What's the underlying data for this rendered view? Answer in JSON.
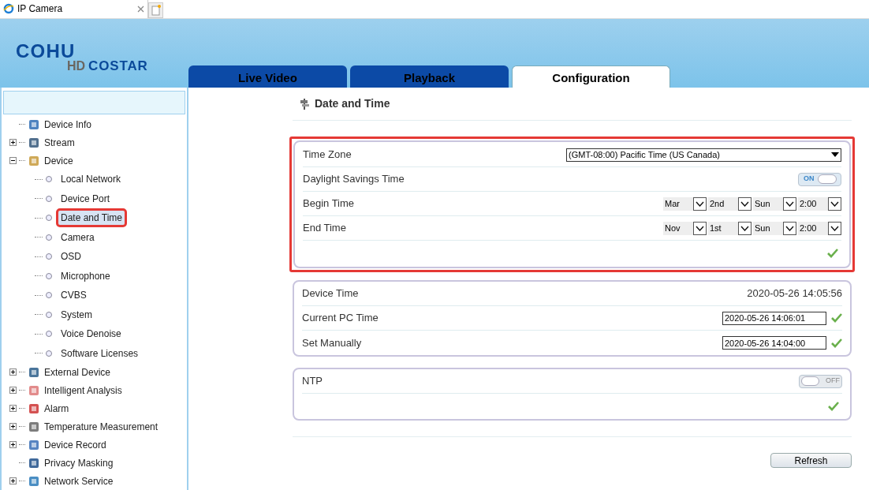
{
  "browser_tab": {
    "title": "IP Camera"
  },
  "logo": {
    "top": "COHU",
    "badge": "HD",
    "bottom": "COSTAR"
  },
  "tabs": [
    {
      "label": "Live Video",
      "selected": false
    },
    {
      "label": "Playback",
      "selected": false
    },
    {
      "label": "Configuration",
      "selected": true
    }
  ],
  "sidebar": {
    "items": [
      {
        "label": "Device Info"
      },
      {
        "label": "Stream",
        "expanded": false
      },
      {
        "label": "Device",
        "expanded": true,
        "children": [
          {
            "label": "Local Network",
            "selected": false
          },
          {
            "label": "Device Port",
            "selected": false
          },
          {
            "label": "Date and Time",
            "selected": true
          },
          {
            "label": "Camera",
            "selected": false
          },
          {
            "label": "OSD",
            "selected": false
          },
          {
            "label": "Microphone",
            "selected": false
          },
          {
            "label": "CVBS",
            "selected": false
          },
          {
            "label": "System",
            "selected": false
          },
          {
            "label": "Voice Denoise",
            "selected": false
          },
          {
            "label": "Software Licenses",
            "selected": false
          }
        ]
      },
      {
        "label": "External Device",
        "expanded": false
      },
      {
        "label": "Intelligent Analysis",
        "expanded": false
      },
      {
        "label": "Alarm",
        "expanded": false
      },
      {
        "label": "Temperature Measurement",
        "expanded": false
      },
      {
        "label": "Device Record",
        "expanded": false
      },
      {
        "label": "Privacy Masking"
      },
      {
        "label": "Network Service",
        "expanded": false
      }
    ]
  },
  "page_title": "Date and Time",
  "time_zone_card": {
    "time_zone": {
      "label": "Time Zone",
      "value": "(GMT-08:00) Pacific Time (US  Canada)"
    },
    "dst": {
      "label": "Daylight Savings Time",
      "on": true,
      "switch_text": "ON"
    },
    "begin": {
      "label": "Begin Time",
      "selects": [
        "Mar",
        "2nd",
        "Sun",
        "2:00"
      ]
    },
    "end": {
      "label": "End Time",
      "selects": [
        "Nov",
        "1st",
        "Sun",
        "2:00"
      ]
    }
  },
  "time_card": {
    "device_time": {
      "label": "Device Time",
      "value": "2020-05-26 14:05:56"
    },
    "pc_time": {
      "label": "Current PC Time",
      "value": "2020-05-26 14:06:01"
    },
    "manual": {
      "label": "Set Manually",
      "value": "2020-05-26 14:04:00"
    }
  },
  "ntp_card": {
    "label": "NTP",
    "on": false,
    "switch_text": "OFF"
  },
  "refresh_button": "Refresh"
}
